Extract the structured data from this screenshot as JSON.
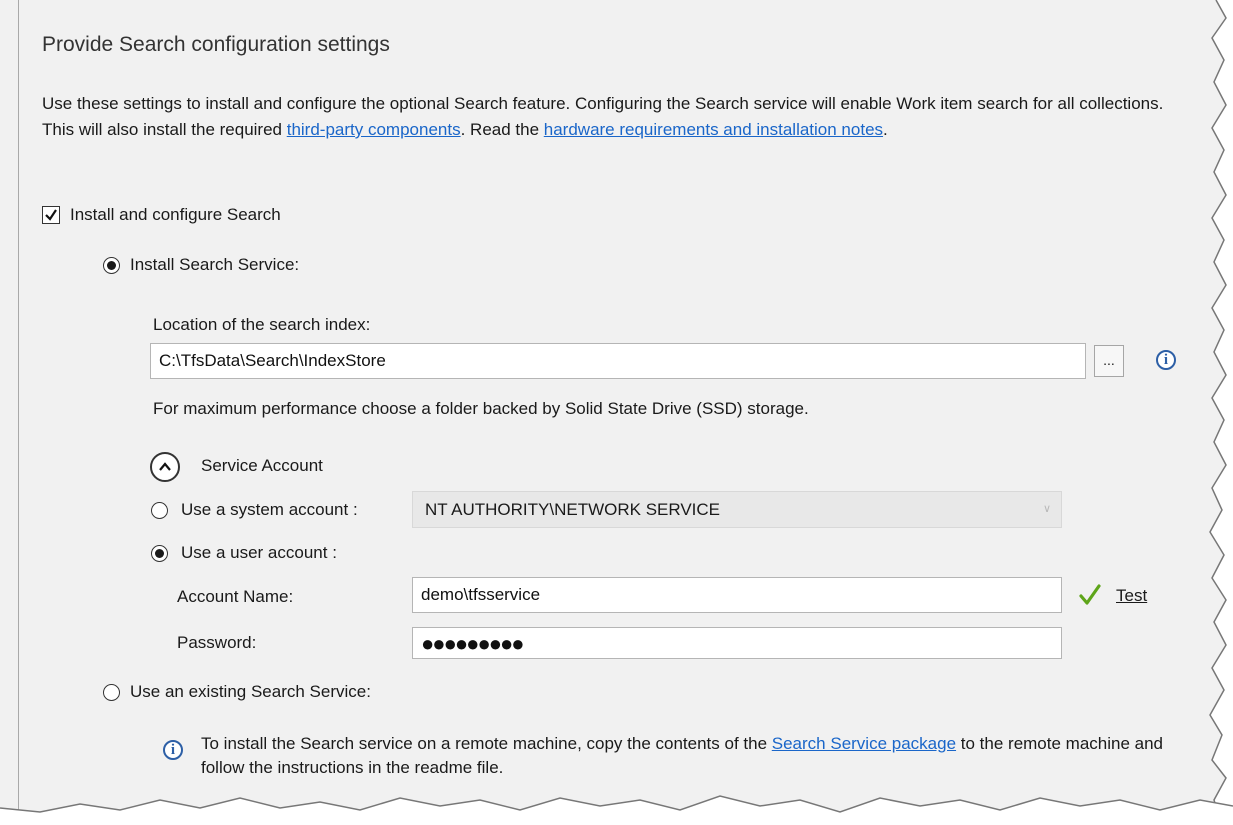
{
  "header": {
    "title": "Provide Search configuration settings"
  },
  "description": {
    "text1": "Use these settings to install and configure the optional Search feature. Configuring the Search service will enable Work item search for all collections. This will also install the required ",
    "link1": "third-party components",
    "text2": ". Read the ",
    "link2": "hardware requirements and installation notes",
    "text3": "."
  },
  "install_search": {
    "label": "Install and configure Search",
    "checked": true
  },
  "install_service": {
    "label": "Install Search Service:",
    "selected": true,
    "location_label": "Location of the search index:",
    "location_value": "C:\\TfsData\\Search\\IndexStore",
    "browse_label": "...",
    "info_icon": "i",
    "hint": "For maximum performance choose a folder backed by Solid State Drive (SSD) storage."
  },
  "service_account": {
    "header": "Service Account",
    "system_account_label": "Use a system account :",
    "system_account_value": "NT AUTHORITY\\NETWORK SERVICE",
    "user_account_label": "Use a user account :",
    "user_account_selected": true,
    "account_name_label": "Account Name:",
    "account_name_value": "demo\\tfsservice",
    "password_label": "Password:",
    "password_value": "●●●●●●●●●",
    "test_link": "Test"
  },
  "existing_service": {
    "label": "Use an existing Search Service:",
    "selected": false,
    "info_text1": "To install the Search service on a remote machine, copy the contents of the ",
    "info_link": "Search Service package",
    "info_text2": " to the remote machine and follow the instructions in the readme file.",
    "info_icon": "i"
  },
  "colors": {
    "panel_bg": "#f1f1f1",
    "link": "#1a66c9",
    "check_green": "#5ea51a",
    "info_blue": "#2d5fa6"
  },
  "icons": [
    "checkbox-check-icon",
    "info-icon",
    "chevron-up-icon",
    "dropdown-arrow-icon",
    "green-check-icon"
  ]
}
